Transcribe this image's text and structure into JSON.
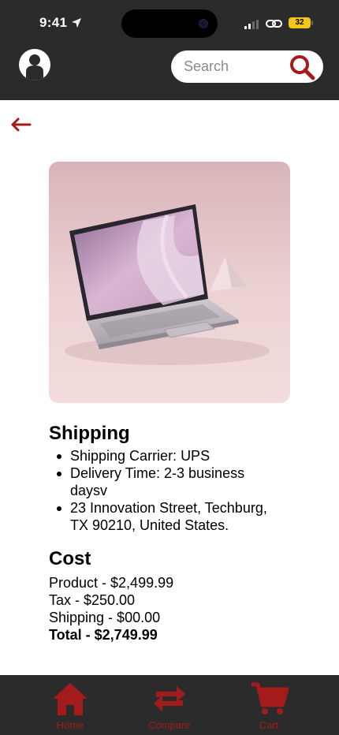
{
  "status_bar": {
    "time": "9:41",
    "battery": "32",
    "icons": [
      "location-arrow-icon",
      "signal-icon",
      "link-icon",
      "battery-icon"
    ]
  },
  "header": {
    "avatar_icon": "user-avatar-icon",
    "search": {
      "placeholder": "Search",
      "value": "",
      "icon": "search-icon"
    }
  },
  "navigation": {
    "back_icon": "back-arrow-icon"
  },
  "product": {
    "image": "laptop-photo"
  },
  "shipping": {
    "title": "Shipping",
    "items": [
      "Shipping Carrier: UPS",
      "Delivery Time: 2-3 business daysv",
      "23 Innovation Street, Techburg, TX 90210, United States."
    ]
  },
  "cost": {
    "title": "Cost",
    "product_line": "Product - $2,499.99",
    "tax_line": "Tax - $250.00",
    "shipping_line": "Shipping - $00.00",
    "total_line": "Total - $2,749.99"
  },
  "tab_bar": {
    "tabs": [
      {
        "label": "Home",
        "icon": "home-icon"
      },
      {
        "label": "Compare",
        "icon": "compare-arrows-icon"
      },
      {
        "label": "Cart",
        "icon": "cart-icon"
      }
    ]
  },
  "colors": {
    "accent": "#a31b1b",
    "bar_background": "#2b2b2b",
    "page_background": "#ffffff"
  }
}
